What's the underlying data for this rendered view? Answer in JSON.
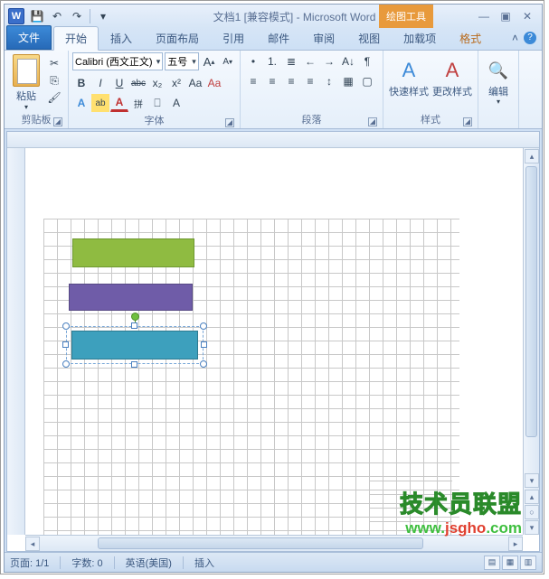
{
  "title": "文档1 [兼容模式] - Microsoft Word",
  "contextual_tab_title": "绘图工具",
  "qat": {
    "save": "💾",
    "undo": "↶",
    "redo": "↷",
    "custom": "▾"
  },
  "win": {
    "min": "—",
    "restore": "▣",
    "close": "✕"
  },
  "tabs": {
    "file": "文件",
    "home": "开始",
    "insert": "插入",
    "layout": "页面布局",
    "ref": "引用",
    "mail": "邮件",
    "review": "审阅",
    "view": "视图",
    "addins": "加载项",
    "format": "格式"
  },
  "ribbon": {
    "clipboard": {
      "paste": "粘贴",
      "label": "剪贴板",
      "cut": "✂",
      "copy": "⎘",
      "painter": "🖌"
    },
    "font": {
      "name": "Calibri (西文正文)",
      "size": "五号",
      "label": "字体",
      "bold": "B",
      "italic": "I",
      "underline": "U",
      "strike": "abc",
      "sub": "x₂",
      "sup": "x²",
      "grow": "A",
      "shrink": "A",
      "clear": "Aa",
      "case": "Aa",
      "highlight": "ab",
      "color": "A",
      "phonetic": "拼",
      "border": "⎕",
      "effects": "A"
    },
    "para": {
      "label": "段落",
      "bullets": "•",
      "numbers": "1.",
      "multilevel": "≣",
      "indent_dec": "←",
      "indent_inc": "→",
      "align_l": "≡",
      "align_c": "≡",
      "align_r": "≡",
      "justify": "≡",
      "spacing": "↕",
      "shade": "▦",
      "borders": "▢",
      "sort": "A↓",
      "marks": "¶"
    },
    "styles": {
      "quick": "快速样式",
      "change": "更改样式",
      "label": "样式"
    },
    "editing": {
      "label": "编辑",
      "find": "🔍"
    }
  },
  "shapes": {
    "green": {
      "color": "#8fbb41"
    },
    "purple": {
      "color": "#6f5ca8"
    },
    "blue": {
      "color": "#3da0bd",
      "selected": true
    }
  },
  "status": {
    "page": "页面: 1/1",
    "words": "字数: 0",
    "lang": "英语(美国)",
    "mode": "插入"
  },
  "watermark": {
    "cn": "技术员联盟",
    "url_prefix": "www.",
    "url_red": "jsgho",
    "url_suffix": ".com"
  }
}
